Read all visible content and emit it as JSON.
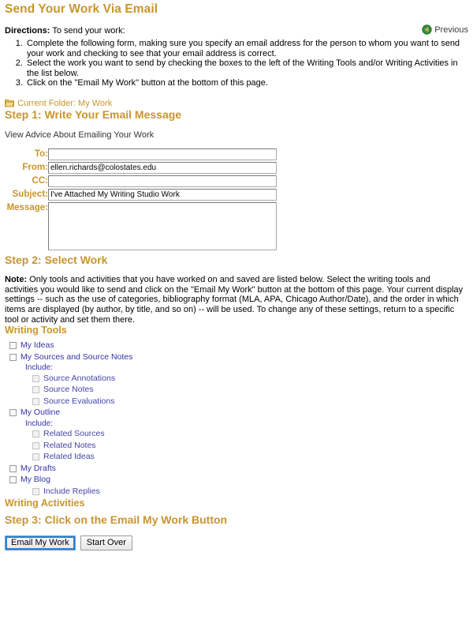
{
  "page": {
    "title": "Send Your Work Via Email"
  },
  "header": {
    "directions_label": "Directions:",
    "directions_lead": " To send your work:",
    "previous_label": "Previous",
    "previous_icon": "back-arrow-circle-icon",
    "steps": [
      "Complete the following form, making sure you specify an email address for the person to whom you want to send your work and checking to see that your email address is correct.",
      "Select the work you want to send by checking the boxes to the left of the Writing Tools and/or Writing Activities in the list below.",
      "Click on the \"Email My Work\" button at the bottom of this page."
    ]
  },
  "folder": {
    "icon": "folder-icon",
    "label": "Current Folder: My Work"
  },
  "step1": {
    "heading": "Step 1: Write Your Email Message",
    "advice_link": "View Advice About Emailing Your Work",
    "fields": {
      "to": {
        "label": "To:",
        "value": "",
        "placeholder": ""
      },
      "from": {
        "label": "From:",
        "value": "ellen.richards@colostates.edu",
        "placeholder": ""
      },
      "cc": {
        "label": "CC:",
        "value": "",
        "placeholder": ""
      },
      "subject": {
        "label": "Subject:",
        "value": "I've Attached My Writing Studio Work",
        "placeholder": ""
      },
      "message": {
        "label": "Message:",
        "value": "",
        "placeholder": ""
      }
    }
  },
  "step2": {
    "heading": "Step 2: Select Work",
    "note_label": "Note:",
    "note_text": " Only tools and activities that you have worked on and saved are listed below. Select the writing tools and activities you would like to send and click on the \"Email My Work\" button at the bottom of this page. Your current display settings -- such as the use of categories, bibliography format (MLA, APA, Chicago Author/Date), and the order in which items are displayed (by author, by title, and so on) -- will be used. To change any of these settings, return to a specific tool or activity and set them there.",
    "writing_tools_heading": "Writing Tools",
    "writing_activities_heading": "Writing Activities",
    "include_label": "Include:",
    "tools": [
      {
        "label": "My Ideas",
        "level": 1,
        "checked": false,
        "disabled": false
      },
      {
        "label": "My Sources and Source Notes",
        "level": 1,
        "checked": false,
        "disabled": false
      },
      {
        "label": "Include:",
        "level": 2,
        "type": "group-label"
      },
      {
        "label": "Source Annotations",
        "level": 3,
        "checked": false,
        "disabled": true
      },
      {
        "label": "Source Notes",
        "level": 3,
        "checked": false,
        "disabled": true
      },
      {
        "label": "Source Evaluations",
        "level": 3,
        "checked": false,
        "disabled": true
      },
      {
        "label": "My Outline",
        "level": 1,
        "checked": false,
        "disabled": false
      },
      {
        "label": "Include:",
        "level": 2,
        "type": "group-label"
      },
      {
        "label": "Related Sources",
        "level": 3,
        "checked": false,
        "disabled": true
      },
      {
        "label": "Related Notes",
        "level": 3,
        "checked": false,
        "disabled": true
      },
      {
        "label": "Related Ideas",
        "level": 3,
        "checked": false,
        "disabled": true
      },
      {
        "label": "My Drafts",
        "level": 1,
        "checked": false,
        "disabled": false
      },
      {
        "label": "My Blog",
        "level": 1,
        "checked": false,
        "disabled": false
      },
      {
        "label": "Include Replies",
        "level": 3,
        "checked": false,
        "disabled": true
      }
    ],
    "activities": []
  },
  "step3": {
    "heading": "Step 3: Click on the Email My Work Button",
    "email_button": "Email My Work",
    "start_over_button": "Start Over"
  },
  "colors": {
    "accent_gold": "#c8952e",
    "link_blue": "#3333aa",
    "text_black": "#000000"
  }
}
